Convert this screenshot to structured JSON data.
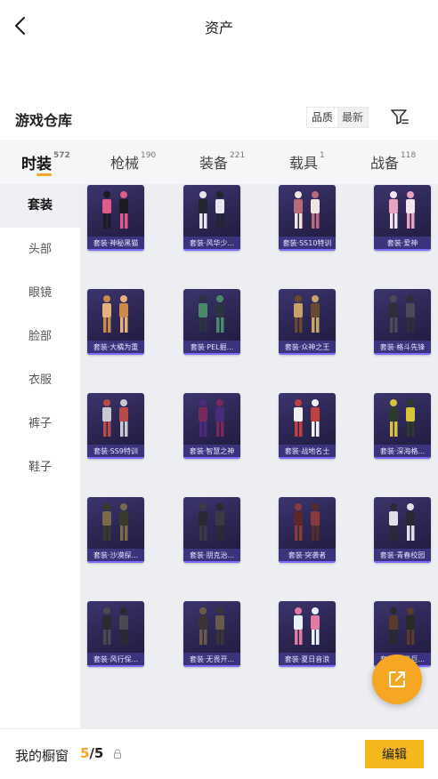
{
  "header": {
    "title": "资产",
    "back_icon": "chevron-left-icon"
  },
  "warehouse": {
    "title": "游戏仓库",
    "sort": [
      "品质",
      "最新"
    ],
    "filter_icon": "filter-icon"
  },
  "tabs": [
    {
      "label": "时装",
      "count": "572"
    },
    {
      "label": "枪械",
      "count": "190"
    },
    {
      "label": "装备",
      "count": "221"
    },
    {
      "label": "载具",
      "count": "1"
    },
    {
      "label": "战备",
      "count": "118"
    }
  ],
  "sidebar": [
    "套装",
    "头部",
    "眼镜",
    "脸部",
    "衣服",
    "裤子",
    "鞋子"
  ],
  "items": [
    {
      "label": "套装·神秘黑猫"
    },
    {
      "label": "套装·风华少..."
    },
    {
      "label": "套装·SS10特训"
    },
    {
      "label": "套装·爱神"
    },
    {
      "label": "套装·大橘为重"
    },
    {
      "label": "套装·PEL掘..."
    },
    {
      "label": "套装·众神之王"
    },
    {
      "label": "套装·格斗先锋"
    },
    {
      "label": "套装·SS9特训"
    },
    {
      "label": "套装·智慧之神"
    },
    {
      "label": "套装·战地名士"
    },
    {
      "label": "套装·深海格..."
    },
    {
      "label": "套装·沙漠探..."
    },
    {
      "label": "套装·朋克治..."
    },
    {
      "label": "套装·突袭者"
    },
    {
      "label": "套装·青春校园"
    },
    {
      "label": "套装·风行保..."
    },
    {
      "label": "套装·无畏开..."
    },
    {
      "label": "套装·夏日音浪"
    },
    {
      "label": "套装·摩登巨..."
    }
  ],
  "bottom": {
    "label": "我的橱窗",
    "current": "5",
    "separator": "/",
    "total": "5",
    "edit_label": "编辑"
  },
  "colors": {
    "accent": "#f5a623",
    "card_bg": "#2a244f"
  }
}
